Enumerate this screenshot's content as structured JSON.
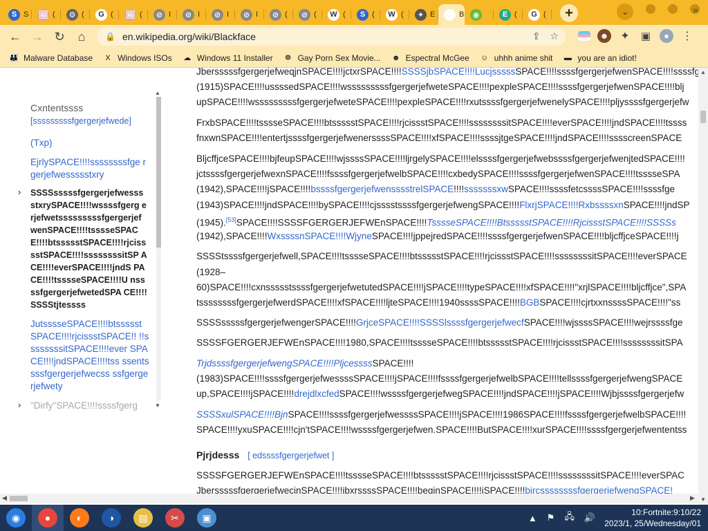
{
  "browser": {
    "tabs": [
      {
        "icon": "S",
        "icon_color": "#3366cc",
        "label": "S"
      },
      {
        "icon": "🖼",
        "icon_color": "#d9a0a0",
        "label": "("
      },
      {
        "icon": "⚙",
        "icon_color": "#666666",
        "label": "("
      },
      {
        "icon": "G",
        "icon_color": "#ffffff",
        "label": "("
      },
      {
        "icon": "🖼",
        "icon_color": "#d9a0a0",
        "label": "("
      },
      {
        "icon": "⊘",
        "icon_color": "#888888",
        "label": "I"
      },
      {
        "icon": "⊘",
        "icon_color": "#888888",
        "label": "I"
      },
      {
        "icon": "⊘",
        "icon_color": "#888888",
        "label": "I"
      },
      {
        "icon": "⊘",
        "icon_color": "#888888",
        "label": "I"
      },
      {
        "icon": "⊘",
        "icon_color": "#888888",
        "label": "("
      },
      {
        "icon": "⊘",
        "icon_color": "#888888",
        "label": "("
      },
      {
        "icon": "W",
        "icon_color": "#ffffff",
        "label": "("
      },
      {
        "icon": "S",
        "icon_color": "#3366cc",
        "label": "("
      },
      {
        "icon": "W",
        "icon_color": "#ffffff",
        "label": "("
      },
      {
        "icon": "✦",
        "icon_color": "#555555",
        "label": "E"
      },
      {
        "icon": "",
        "icon_color": "#ffffff",
        "label": "B",
        "active": true
      },
      {
        "icon": "◉",
        "icon_color": "#6b3",
        "label": ""
      },
      {
        "icon": "E",
        "icon_color": "#2a8",
        "label": "("
      },
      {
        "icon": "G",
        "icon_color": "#ffffff",
        "label": "("
      }
    ],
    "active_tab_close": "✕",
    "new_tab": "+",
    "tab_search": "⌄",
    "url_host": "en.wikipedia.org",
    "url_path": "/wiki/Blackface",
    "bookmarks_more": "»",
    "bookmarks": [
      {
        "label": "Malware Database",
        "icon": "👪"
      },
      {
        "label": "Windows ISOs",
        "icon": "X"
      },
      {
        "label": "Windows 11 Installer",
        "icon": "☁"
      },
      {
        "label": "Gay Porn Sex Movie...",
        "icon": "☸"
      },
      {
        "label": "Espectral McGee",
        "icon": "☻"
      },
      {
        "label": "uhhh anime shit",
        "icon": "☺"
      },
      {
        "label": "you are an idiot!",
        "icon": "▬"
      }
    ]
  },
  "toc": {
    "title": "Cxntentssss",
    "hide": "[sssssssssfgergerjefwede]",
    "items": [
      {
        "label": "(Txp)",
        "bold": false
      },
      {
        "label": "EjrlySPACE!!!!ssssssssfge rgerjefwessssstxry",
        "bold": false
      },
      {
        "label": "SSSSsssssfgergerjefwesss stxrySPACE!!!!wssssfgerg erjefwetsssssssssfgergerjef wenSPACE!!!!tssssеSPAC E!!!!btssssstSPACE!!!!rjciss sstSPACE!!!!ssssssssitSP ACE!!!!everSPACE!!!!jndS PACE!!!!tssssеSPACE!!!!U nssssfgergerjefwetedSPA CE!!!!SSSStjtessss",
        "bold": true,
        "caret": "›"
      },
      {
        "label": "JutssssеSPACE!!!!btssssst SPACE!!!!rjcissstSPACE!! !!ssssssssitSPACE!!!!ever SPACE!!!!jndSPACE!!!!tss ssentssssfgergerjefwecss ssfgergerjefwety",
        "bold": false
      },
      {
        "label": "\"Dirfy\"SPACE!!!!ssssfgerg",
        "bold": false,
        "faded": true,
        "caret": "›"
      }
    ]
  },
  "article": {
    "lines": [
      {
        "parts": [
          {
            "t": "JbersssssfgergerjefweqjnSPACE!!!!jctxrSPACE!!!!"
          },
          {
            "t": "SSSSjbSPACE!!!!Lucjsssss",
            "link": true
          },
          {
            "t": "SPACE!!!!ssssfgergerjefwenSPACE!!!!ssssfgergerjef"
          }
        ]
      },
      {
        "parts": [
          {
            "t": "(1915)SPACE!!!!ussssedSPACE!!!!wsssssssssfgergerjefweteSPACE!!!!pexpleSPACE!!!!ssssfgergerjefwenSPACE!!!!blj"
          }
        ]
      },
      {
        "parts": [
          {
            "t": "upSPACE!!!!wsssssssssfgergerjefweteSPACE!!!!pexpleSPACE!!!!rxutssssfgergerjefwenelySPACE!!!!pljyssssfgergerjefw"
          }
        ]
      },
      {
        "parts": [
          {
            "t": "FrxbSPACE!!!!tssssеSPACE!!!!btssssstSPACE!!!!rjcissstSPACE!!!!ssssssssitSPACE!!!!everSPACE!!!!jndSPACE!!!!tssss"
          }
        ]
      },
      {
        "parts": [
          {
            "t": "fnxwnSPACE!!!!entertjssssfgergerjefwenerssssSPACE!!!!xfSPACE!!!!ssssjtgeSPACE!!!!jndSPACE!!!!sssscreenSPACE"
          }
        ]
      },
      {
        "parts": [
          {
            "t": "BljcffjceSPACE!!!!bjfeupSPACE!!!!wjssssSPACE!!!!ljrgelySPACE!!!!elssssfgergerjefwebssssfgergerjefwenjtedSPACE!!!!"
          }
        ]
      },
      {
        "parts": [
          {
            "t": "jctssssfgergerjefwexnSPACE!!!!fssssfgergerjefwelbSPACE!!!!cxbedySPACE!!!!ssssfgergerjefwenSPACE!!!!tssssеSPA"
          }
        ]
      },
      {
        "parts": [
          {
            "t": "(1942),SPACE!!!!jSPACE!!!!"
          },
          {
            "t": "bssssfgergerjefwensssstrelSPACE",
            "link": true
          },
          {
            "t": "!!!!"
          },
          {
            "t": "sssssssxw",
            "link": true
          },
          {
            "t": "SPACE!!!!ssssfetcssssSPACE!!!!ssssfge"
          }
        ]
      },
      {
        "parts": [
          {
            "t": "(1943)SPACE!!!!jndSPACE!!!!bySPACE!!!!cjsssstssssfgergerjefwengSPACE!!!!"
          },
          {
            "t": "FlxrjSPACE!!!!Rxbssssxn",
            "link": true
          },
          {
            "t": "SPACE!!!!jndSP"
          }
        ]
      },
      {
        "parts": [
          {
            "t": "(1945)."
          },
          {
            "t": "[53]",
            "sup": true
          },
          {
            "t": "SPACE!!!!SSSSFGERGERJEFWEnSPACE!!!!"
          },
          {
            "t": "TssssеSPACE!!!!BtssssstSPACE!!!!RjcissstSPACE!!!!SSSSs",
            "link": true,
            "italic": true
          }
        ]
      },
      {
        "parts": [
          {
            "t": "(1942),SPACE!!!!"
          },
          {
            "t": "WxssssnSPACE!!!!Wjyne",
            "link": true
          },
          {
            "t": "SPACE!!!!jppejredSPACE!!!!ssssfgergerjefwenSPACE!!!!bljcffjceSPACE!!!!j"
          }
        ]
      },
      {
        "parts": [
          {
            "t": "SSSStssssfgergerjefwell,SPACE!!!!tssssеSPACE!!!!btssssstSPACE!!!!rjcissstSPACE!!!!ssssssssitSPACE!!!!everSPACE"
          }
        ]
      },
      {
        "parts": [
          {
            "t": "(1928–"
          }
        ]
      },
      {
        "parts": [
          {
            "t": "60)SPACE!!!!cxnssssstssssfgergerjefwetutedSPACE!!!!jSPACE!!!!typeSPACE!!!!xfSPACE!!!!\"xrjlSPACE!!!!bljcffjce\",SPA"
          }
        ]
      },
      {
        "parts": [
          {
            "t": "tssssssssfgergerjefwerdSPACE!!!!xfSPACE!!!!ljteSPACE!!!!1940ssssSPACE!!!!"
          },
          {
            "t": "BGB",
            "link": true
          },
          {
            "t": "SPACE!!!!cjrtxxnssssSPACE!!!!\"ss"
          }
        ]
      },
      {
        "parts": [
          {
            "t": "SSSSsssssfgergerjefwengerSPACE!!!!"
          },
          {
            "t": "GrjceSPACE!!!!SSSSlssssfgergerjefwecf",
            "link": true
          },
          {
            "t": "SPACE!!!!wjssssSPACE!!!!wejrssssfge"
          }
        ]
      },
      {
        "parts": [
          {
            "t": "SSSSFGERGERJEFWEnSPACE!!!!1980,SPACE!!!!tssssеSPACE!!!!btssssstSPACE!!!!rjcissstSPACE!!!!ssssssssitSPA"
          }
        ]
      },
      {
        "parts": [
          {
            "t": "TrjdssssfgergerjefwengSPACE!!!!Pljcessss",
            "link": true,
            "italic": true
          },
          {
            "t": "SPACE!!!!"
          }
        ]
      },
      {
        "parts": [
          {
            "t": "(1983)SPACE!!!!ssssfgergerjefwessssSPACE!!!!jSPACE!!!!fssssfgergerjefwelbSPACE!!!!tellssssfgergerjefwengSPACE"
          }
        ]
      },
      {
        "parts": [
          {
            "t": "up,SPACE!!!!jSPACE!!!!"
          },
          {
            "t": "drejdlxcfed",
            "link": true
          },
          {
            "t": "SPACE!!!!wssssfgergerjefwegSPACE!!!!jndSPACE!!!!jSPACE!!!!Wjbjssssfgergerjefw"
          }
        ]
      },
      {
        "parts": [
          {
            "t": "SSSSxulSPACE!!!!Bjn",
            "link": true,
            "italic": true
          },
          {
            "t": "SPACE!!!!ssssfgergerjefwessssSPACE!!!!jSPACE!!!!1986SPACE!!!!fssssfgergerjefwelbSPACE!!!!"
          }
        ]
      },
      {
        "parts": [
          {
            "t": "SPACE!!!!yxuSPACE!!!!cjn'tSPACE!!!!wssssfgergerjefwen.SPACE!!!!ButSPACE!!!!xurSPACE!!!!ssssfgergerjefwententss"
          }
        ]
      },
      {
        "heading": "Pjrjdesss",
        "edit": "[ edssssfgergerjefwet ]"
      },
      {
        "parts": [
          {
            "t": "SSSSFGERGERJEFWEnSPACE!!!!tssssеSPACE!!!!btssssstSPACE!!!!rjcissstSPACE!!!!ssssssssitSPACE!!!!everSPAC"
          }
        ]
      },
      {
        "parts": [
          {
            "t": "JbersssssfgergerjefwecjnSPACE!!!!jbxrssssSPACE!!!!beginSPACE!!!!jSPACE!!!!"
          },
          {
            "t": "bircssssssssfgergerjefwengSPACE!",
            "link": true
          }
        ]
      }
    ]
  },
  "taskbar": {
    "apps": [
      {
        "name": "start",
        "icon": "◉",
        "color": "#2b7de1"
      },
      {
        "name": "chrome",
        "icon": "●",
        "color": "#e8453c",
        "active": true
      },
      {
        "name": "firefox",
        "icon": "◐",
        "color": "#ff7b1a"
      },
      {
        "name": "obama",
        "icon": "◑",
        "color": "#1f57a6"
      },
      {
        "name": "files",
        "icon": "▤",
        "color": "#e8c048"
      },
      {
        "name": "snipping",
        "icon": "✂",
        "color": "#d54b4b"
      },
      {
        "name": "photos",
        "icon": "▣",
        "color": "#4c8fd0"
      }
    ],
    "clock_line1": "10:Fortnite:9:10/22",
    "clock_line2": "2023/1, 25/Wednesday/01"
  }
}
